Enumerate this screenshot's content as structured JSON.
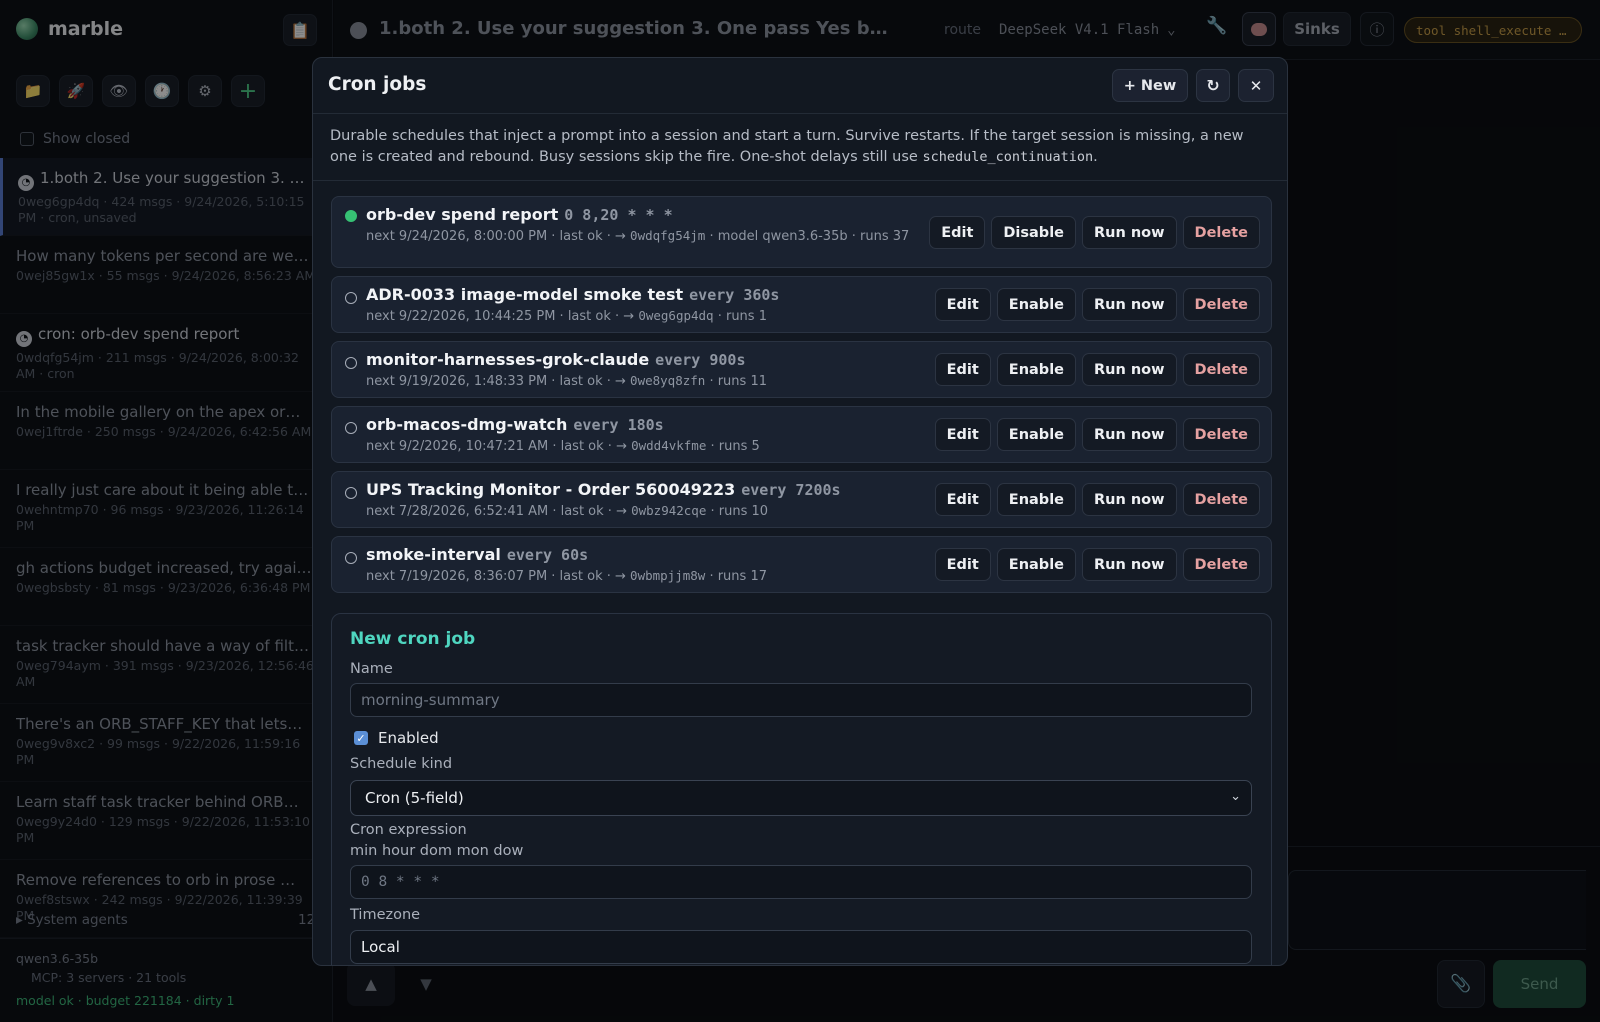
{
  "app": {
    "name": "marble"
  },
  "sidebar": {
    "show_closed_label": "Show closed",
    "tool_icons": [
      "folder-icon",
      "rocket-icon",
      "eye-icon",
      "clock-icon",
      "gear-icon",
      "plus-icon"
    ],
    "sessions": [
      {
        "title": "1.both 2. Use your suggestion 3. One pass Yes b…",
        "meta": "0weg6gp4dq · 424 msgs · 9/24/2026, 5:10:15 PM · cron, unsaved",
        "active": true,
        "clock": true
      },
      {
        "title": "How many tokens per second are we getting…",
        "meta": "0wej85gw1x · 55 msgs · 9/24/2026, 8:56:23 AM",
        "active": false,
        "clock": false
      },
      {
        "title": "cron: orb-dev spend report",
        "meta": "0wdqfg54jm · 211 msgs · 9/24/2026, 8:00:32 AM · cron",
        "active": false,
        "clock": true
      },
      {
        "title": "In the mobile gallery on the apex or…",
        "meta": "0wej1ftrde · 250 msgs · 9/24/2026, 6:42:56 AM",
        "active": false,
        "clock": false
      },
      {
        "title": "I really just care about it being able to…",
        "meta": "0wehntmp70 · 96 msgs · 9/23/2026, 11:26:14 PM",
        "active": false,
        "clock": false
      },
      {
        "title": "gh actions budget increased, try again…",
        "meta": "0wegbsbsty · 81 msgs · 9/23/2026, 6:36:48 PM",
        "active": false,
        "clock": false
      },
      {
        "title": "task tracker should have a way of filtering…",
        "meta": "0weg794aym · 391 msgs · 9/23/2026, 12:56:46 AM",
        "active": false,
        "clock": false
      },
      {
        "title": "There's an ORB_STAFF_KEY that lets…",
        "meta": "0weg9v8xc2 · 99 msgs · 9/22/2026, 11:59:16 PM",
        "active": false,
        "clock": false
      },
      {
        "title": "Learn staff task tracker behind ORB…",
        "meta": "0weg9y24d0 · 129 msgs · 9/22/2026, 11:53:10 PM",
        "active": false,
        "clock": false
      },
      {
        "title": "Remove references to orb in prose …",
        "meta": "0wef8stswx · 242 msgs · 9/22/2026, 11:39:39 PM",
        "active": false,
        "clock": false
      }
    ],
    "system_agents_label": "▸ System agents",
    "system_agents_count": "12",
    "model": "qwen3.6-35b",
    "mcp": "MCP: 3 servers · 21 tools",
    "status": "model ok · budget 221184 · dirty 1"
  },
  "topbar": {
    "title": "1.both 2. Use your suggestion 3. One pass Yes b… · 0we…",
    "route_label": "route",
    "model_select": "DeepSeek V4.1 Flash",
    "sinks_label": "Sinks",
    "info_icon": "ⓘ",
    "tool_badge": "tool shell_execute …"
  },
  "modal": {
    "title": "Cron jobs",
    "new_label": "+ New",
    "refresh_icon": "↻",
    "close_icon": "✕",
    "desc_main": "Durable schedules that inject a prompt into a session and start a turn. Survive restarts. If the target session is missing, a new one is created and rebound. Busy sessions skip the fire. One-shot delays still use ",
    "desc_code": "schedule_continuation",
    "desc_end": ".",
    "jobs": [
      {
        "name": "orb-dev spend report",
        "schedule": "0 8,20 * * *",
        "enabled": true,
        "toggle": "Disable",
        "next": "next 9/24/2026, 8:00:00 PM · last ok · → ",
        "target": "0wdqfg54jm",
        "extra": " · model qwen3.6-35b · runs 37"
      },
      {
        "name": "ADR-0033 image-model smoke test",
        "schedule": "every 360s",
        "enabled": false,
        "toggle": "Enable",
        "next": "next 9/22/2026, 10:44:25 PM · last ok · → ",
        "target": "0weg6gp4dq",
        "extra": " · runs 1"
      },
      {
        "name": "monitor-harnesses-grok-claude",
        "schedule": "every 900s",
        "enabled": false,
        "toggle": "Enable",
        "next": "next 9/19/2026, 1:48:33 PM · last ok · → ",
        "target": "0we8yq8zfn",
        "extra": " · runs 11"
      },
      {
        "name": "orb-macos-dmg-watch",
        "schedule": "every 180s",
        "enabled": false,
        "toggle": "Enable",
        "next": "next 9/2/2026, 10:47:21 AM · last ok · → ",
        "target": "0wdd4vkfme",
        "extra": " · runs 5"
      },
      {
        "name": "UPS Tracking Monitor - Order 560049223",
        "schedule": "every 7200s",
        "enabled": false,
        "toggle": "Enable",
        "next": "next 7/28/2026, 6:52:41 AM · last ok · → ",
        "target": "0wbz942cqe",
        "extra": " · runs 10"
      },
      {
        "name": "smoke-interval",
        "schedule": "every 60s",
        "enabled": false,
        "toggle": "Enable",
        "next": "next 7/19/2026, 8:36:07 PM · last ok · → ",
        "target": "0wbmpjjm8w",
        "extra": " · runs 17"
      }
    ],
    "action_labels": {
      "edit": "Edit",
      "run": "Run now",
      "delete": "Delete"
    },
    "new_form": {
      "title": "New cron job",
      "name_label": "Name",
      "name_placeholder": "morning-summary",
      "enabled_label": "Enabled",
      "kind_label": "Schedule kind",
      "kind_value": "Cron (5-field)",
      "expr_label": "Cron expression",
      "expr_hint": "min hour dom mon dow",
      "expr_placeholder": "0 8 * * *",
      "tz_label": "Timezone",
      "tz_value": "Local"
    }
  },
  "composer": {
    "up_icon": "▲",
    "down_icon": "▼",
    "attach_icon": "paperclip-icon",
    "send_label": "Send"
  },
  "colors": {
    "accent_teal": "#4fd6c0",
    "enabled_green": "#36c174",
    "delete_red": "#e5a1a1",
    "tool_badge": "#c99f4a"
  }
}
